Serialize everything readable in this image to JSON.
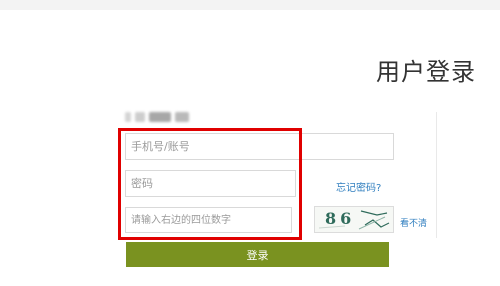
{
  "header": {
    "title": "用户登录"
  },
  "form": {
    "username_placeholder": "手机号/账号",
    "password_placeholder": "密码",
    "captcha_placeholder": "请输入右边的四位数字",
    "forgot_password_label": "忘记密码?",
    "captcha_text": "86",
    "refresh_captcha_label": "看不清",
    "submit_label": "登录"
  },
  "colors": {
    "submit_bg": "#7a9220",
    "link": "#2f7ebf",
    "highlight": "#e00000"
  }
}
